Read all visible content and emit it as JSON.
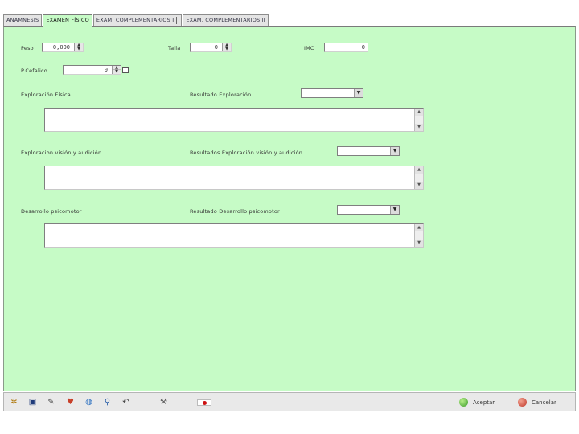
{
  "tabs": [
    {
      "label": "ANAMNESIS",
      "active": false
    },
    {
      "label": "EXAMEN FÍSICO",
      "active": true
    },
    {
      "label": "EXAM. COMPLEMENTARIOS I",
      "active": false
    },
    {
      "label": "EXAM. COMPLEMENTARIOS II",
      "active": false
    }
  ],
  "form": {
    "peso": {
      "label": "Peso",
      "value": "0,000"
    },
    "talla": {
      "label": "Talla",
      "value": "0"
    },
    "imc": {
      "label": "IMC",
      "value": "0"
    },
    "p_cefalico": {
      "label": "P.Cefalico",
      "value": "0"
    },
    "exploracion_fisica": {
      "label": "Exploración Física",
      "result_label": "Resultado Exploración",
      "result_value": ""
    },
    "exploracion_vision": {
      "label": "Exploracion visión y audición",
      "result_label": "Resultados Exploración visión y audición",
      "result_value": ""
    },
    "desarrollo": {
      "label": "Desarrollo psicomotor",
      "result_label": "Resultado Desarrollo psicomotor",
      "result_value": ""
    }
  },
  "toolbar": {
    "icons": [
      "gear-icon",
      "save-icon",
      "pen-icon",
      "heart-icon",
      "globe-icon",
      "search-icon",
      "undo-icon",
      "tools-icon",
      "flag-icon"
    ],
    "accept_label": "Aceptar",
    "cancel_label": "Cancelar"
  },
  "colors": {
    "panel_bg": "#c6fbc6",
    "accept": "#3a9a2a",
    "cancel": "#c0392b"
  }
}
